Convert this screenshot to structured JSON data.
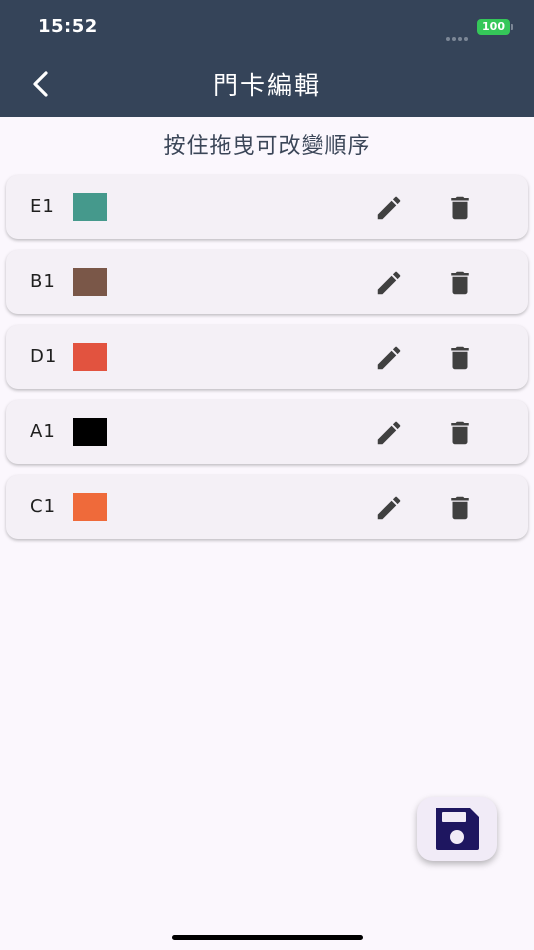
{
  "status_bar": {
    "time": "15:52",
    "battery": "100"
  },
  "header": {
    "title": "門卡編輯",
    "back_icon": "chevron-left-icon"
  },
  "hint": "按住拖曳可改變順序",
  "cards": [
    {
      "label": "E1",
      "color": "#45998c"
    },
    {
      "label": "B1",
      "color": "#7a5748"
    },
    {
      "label": "D1",
      "color": "#e2533f"
    },
    {
      "label": "A1",
      "color": "#000000"
    },
    {
      "label": "C1",
      "color": "#ef6a3a"
    }
  ],
  "icons": {
    "edit": "pencil-icon",
    "delete": "trash-icon",
    "save": "floppy-disk-icon"
  },
  "colors": {
    "header_bg": "#354459",
    "icon": "#404040",
    "save_icon": "#1e1660",
    "background": "#fbf7fd"
  }
}
